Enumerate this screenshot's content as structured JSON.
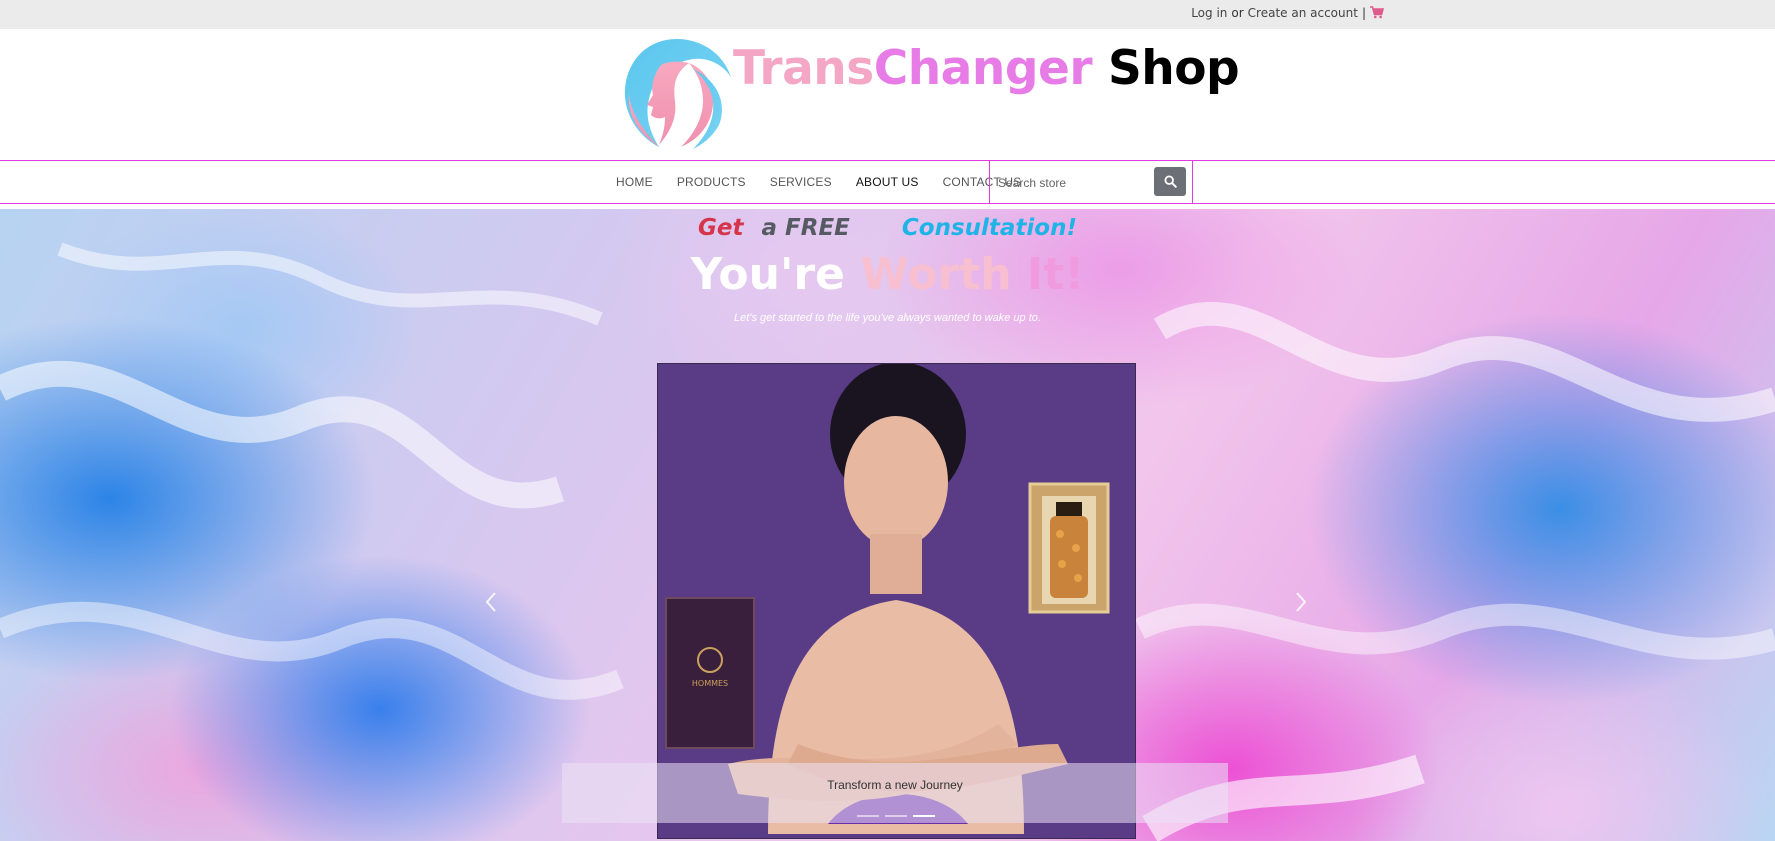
{
  "topbar": {
    "login": "Log in",
    "or": "or",
    "create_account": "Create an account",
    "separator": "|",
    "cart_icon": "cart-icon"
  },
  "brand": {
    "part1": "Trans",
    "part2": "Changer",
    "part3": "Shop",
    "colors": {
      "part1": "#f4a7c4",
      "part2": "#e77ce6",
      "part3": "#000000"
    }
  },
  "nav": {
    "items": [
      {
        "label": "HOME"
      },
      {
        "label": "PRODUCTS"
      },
      {
        "label": "SERVICES"
      },
      {
        "label": "ABOUT US"
      },
      {
        "label": "CONTACT US"
      }
    ],
    "active_index": 3,
    "search": {
      "placeholder": "Search store",
      "button_icon": "search-icon"
    },
    "border_color": "#e03ae0"
  },
  "hero": {
    "tagline": {
      "get": "Get",
      "free": "a FREE",
      "consult": "Consultation!"
    },
    "headline": {
      "part1": "You're",
      "part2": "Worth",
      "part3": "It!"
    },
    "subline": "Let's get started to the life you've always wanted to wake up to.",
    "carousel": {
      "caption": "Transform a new Journey",
      "slide_count": 3,
      "active_slide": 3,
      "prev_icon": "chevron-left-icon",
      "next_icon": "chevron-right-icon"
    },
    "product_box_label": "HOMMES"
  }
}
